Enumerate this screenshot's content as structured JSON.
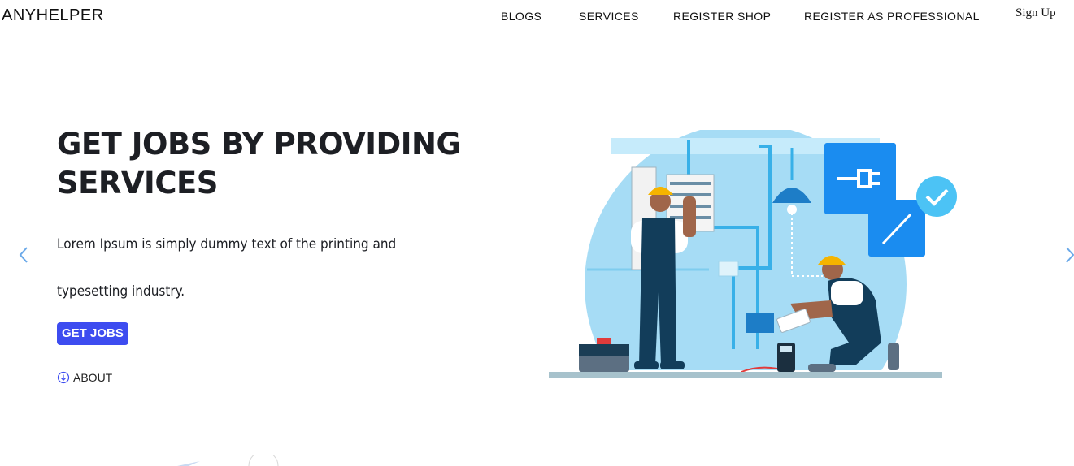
{
  "header": {
    "brand": "ANYHELPER",
    "nav": [
      {
        "label": "BLOGS"
      },
      {
        "label": "SERVICES"
      },
      {
        "label": "REGISTER SHOP"
      },
      {
        "label": "REGISTER AS PROFESSIONAL"
      }
    ],
    "signup_label": "Sign Up"
  },
  "hero": {
    "title": "GET JOBS BY PROVIDING SERVICES",
    "description": "Lorem Ipsum is simply dummy text of the printing and typesetting industry.",
    "cta_label": "GET JOBS",
    "about_label": "ABOUT",
    "about_icon": "arrow-down-circle-icon"
  },
  "carousel": {
    "prev_icon": "chevron-left-icon",
    "next_icon": "chevron-right-icon"
  },
  "colors": {
    "accent": "#3d4cf0",
    "arrow": "#6aa9e9",
    "illustration_light": "#8fd3f2",
    "illustration_blue": "#1a8cf0"
  }
}
